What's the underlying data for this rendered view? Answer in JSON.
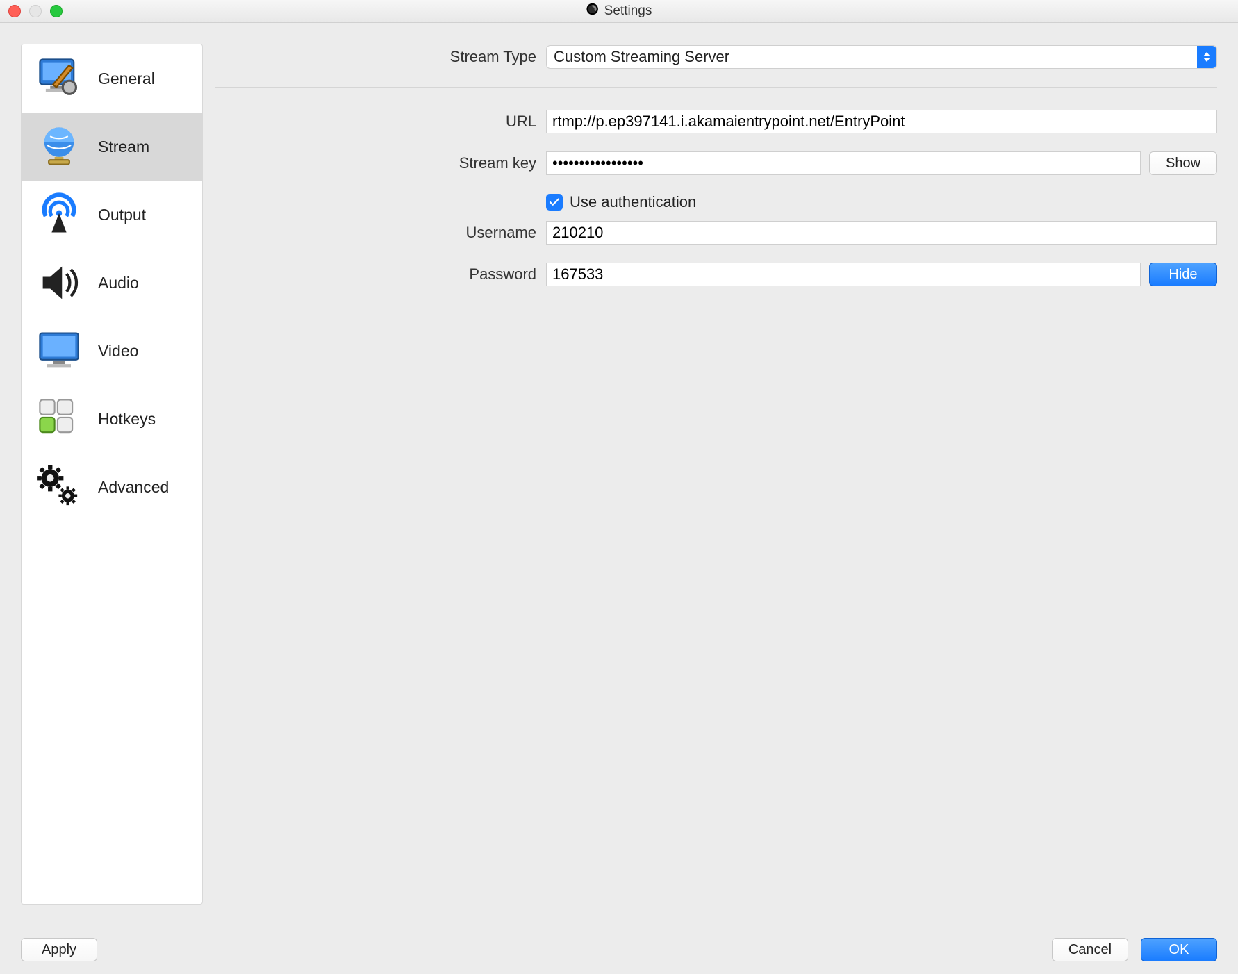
{
  "window": {
    "title": "Settings"
  },
  "sidebar": {
    "items": [
      {
        "label": "General"
      },
      {
        "label": "Stream"
      },
      {
        "label": "Output"
      },
      {
        "label": "Audio"
      },
      {
        "label": "Video"
      },
      {
        "label": "Hotkeys"
      },
      {
        "label": "Advanced"
      }
    ],
    "selected_index": 1
  },
  "form": {
    "stream_type": {
      "label": "Stream Type",
      "value": "Custom Streaming Server"
    },
    "url": {
      "label": "URL",
      "value": "rtmp://p.ep397141.i.akamaientrypoint.net/EntryPoint"
    },
    "stream_key": {
      "label": "Stream key",
      "value": "•••••••••••••••••",
      "show_label": "Show"
    },
    "use_auth": {
      "label": "Use authentication",
      "checked": true
    },
    "username": {
      "label": "Username",
      "value": "210210"
    },
    "password": {
      "label": "Password",
      "value": "167533",
      "hide_label": "Hide"
    }
  },
  "footer": {
    "apply": "Apply",
    "cancel": "Cancel",
    "ok": "OK"
  },
  "colors": {
    "accent": "#1a7cff"
  }
}
